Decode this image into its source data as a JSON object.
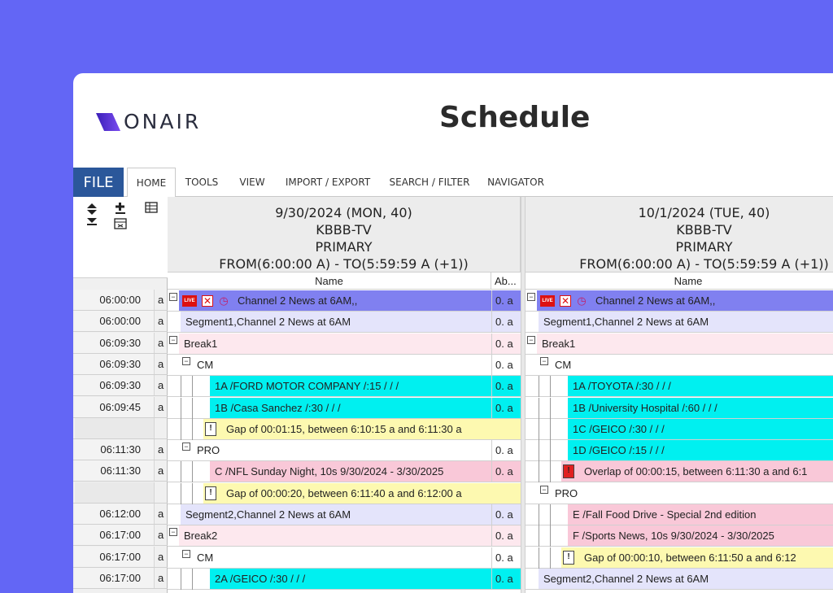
{
  "brand": {
    "logo_text": "ONAIR",
    "logo_color": "#5b2bd6"
  },
  "page_title": "Schedule",
  "ribbon": {
    "file_label": "FILE",
    "tabs": [
      "HOME",
      "TOOLS",
      "VIEW",
      "IMPORT / EXPORT",
      "SEARCH / FILTER",
      "NAVIGATOR"
    ],
    "active_tab": "HOME"
  },
  "toolbar_icons": [
    "expand-collapse-icon",
    "add-item-icon",
    "grid-icon",
    "form-icon"
  ],
  "times": [
    {
      "time": "06:00:00",
      "ampm": "a"
    },
    {
      "time": "06:00:00",
      "ampm": "a"
    },
    {
      "time": "06:09:30",
      "ampm": "a"
    },
    {
      "time": "06:09:30",
      "ampm": "a"
    },
    {
      "time": "06:09:30",
      "ampm": "a"
    },
    {
      "time": "06:09:45",
      "ampm": "a"
    },
    {
      "time": "",
      "ampm": ""
    },
    {
      "time": "06:11:30",
      "ampm": "a"
    },
    {
      "time": "06:11:30",
      "ampm": "a"
    },
    {
      "time": "",
      "ampm": ""
    },
    {
      "time": "06:12:00",
      "ampm": "a"
    },
    {
      "time": "06:17:00",
      "ampm": "a"
    },
    {
      "time": "06:17:00",
      "ampm": "a"
    },
    {
      "time": "06:17:00",
      "ampm": "a"
    }
  ],
  "days": [
    {
      "date": "9/30/2024 (MON, 40)",
      "station": "KBBB-TV",
      "feed": "PRIMARY",
      "range": "FROM(6:00:00 A) - TO(5:59:59 A (+1))",
      "col_name": "Name",
      "col_ab": "Ab...",
      "rows": [
        {
          "text": "Channel 2 News at 6AM,,",
          "ab": "0. a",
          "kind": "program"
        },
        {
          "text": "Segment1,Channel 2 News at 6AM",
          "ab": "0. a",
          "kind": "segment"
        },
        {
          "text": "Break1",
          "ab": "0. a",
          "kind": "break"
        },
        {
          "text": "CM",
          "ab": "0. a",
          "kind": "cm"
        },
        {
          "text": "1A /FORD MOTOR COMPANY /:15 / / /",
          "ab": "0. a",
          "kind": "spot"
        },
        {
          "text": "1B /Casa Sanchez /:30 / / /",
          "ab": "0. a",
          "kind": "spot"
        },
        {
          "text": "Gap of 00:01:15, between 6:10:15 a and 6:11:30 a",
          "ab": "",
          "kind": "gap"
        },
        {
          "text": "PRO",
          "ab": "0. a",
          "kind": "cm"
        },
        {
          "text": "C /NFL Sunday Night, 10s 9/30/2024 - 3/30/2025",
          "ab": "0. a",
          "kind": "promo"
        },
        {
          "text": "Gap of 00:00:20, between 6:11:40 a and 6:12:00 a",
          "ab": "",
          "kind": "gap"
        },
        {
          "text": "Segment2,Channel 2 News at 6AM",
          "ab": "0. a",
          "kind": "segment"
        },
        {
          "text": "Break2",
          "ab": "0. a",
          "kind": "break"
        },
        {
          "text": "CM",
          "ab": "0. a",
          "kind": "cm"
        },
        {
          "text": "2A /GEICO /:30 / / /",
          "ab": "0. a",
          "kind": "spot"
        }
      ]
    },
    {
      "date": "10/1/2024 (TUE, 40)",
      "station": "KBBB-TV",
      "feed": "PRIMARY",
      "range": "FROM(6:00:00 A) - TO(5:59:59 A (+1))",
      "col_name": "Name",
      "rows": [
        {
          "text": "Channel 2 News at 6AM,,",
          "kind": "program"
        },
        {
          "text": "Segment1,Channel 2 News at 6AM",
          "kind": "segment"
        },
        {
          "text": "Break1",
          "kind": "break"
        },
        {
          "text": "CM",
          "kind": "cm"
        },
        {
          "text": "1A /TOYOTA /:30 / / /",
          "kind": "spot"
        },
        {
          "text": "1B /University Hospital /:60 / / /",
          "kind": "spot"
        },
        {
          "text": "1C /GEICO /:30 / / /",
          "kind": "spot"
        },
        {
          "text": "1D /GEICO /:15 / / /",
          "kind": "spot"
        },
        {
          "text": "Overlap of 00:00:15, between 6:11:30 a and 6:1",
          "kind": "overlap"
        },
        {
          "text": "PRO",
          "kind": "cm"
        },
        {
          "text": "E /Fall Food Drive - Special 2nd edition",
          "kind": "promo"
        },
        {
          "text": "F /Sports News, 10s 9/30/2024 - 3/30/2025",
          "kind": "promo"
        },
        {
          "text": "Gap of 00:00:10, between 6:11:50 a and 6:12",
          "kind": "gap"
        },
        {
          "text": "Segment2,Channel 2 News at 6AM",
          "kind": "segment"
        }
      ]
    }
  ],
  "colors": {
    "program": "#8080f0",
    "segment": "#e4e4fb",
    "break": "#fde8ee",
    "spot": "#00f0f0",
    "promo": "#f9c8d8",
    "gap": "#fdf9b0",
    "overlap": "#f9c8d8"
  }
}
